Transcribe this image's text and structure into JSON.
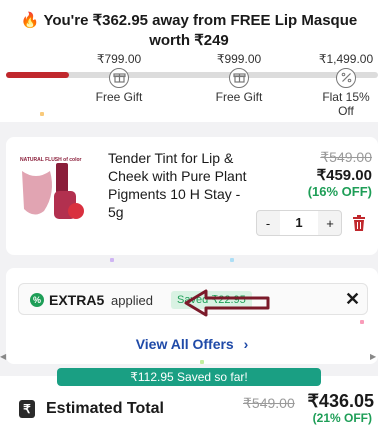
{
  "banner": {
    "message": "You're ₹362.95 away from FREE Lip Masque worth ₹249",
    "fire_icon": "fire-icon",
    "progress": 0.17,
    "colors": {
      "fill": "#c0282d",
      "track": "#dcdcdc"
    },
    "milestones": [
      {
        "price": "₹799.00",
        "label": "Free Gift",
        "icon": "gift-icon"
      },
      {
        "price": "₹999.00",
        "label": "Free Gift",
        "icon": "gift-icon"
      },
      {
        "price": "₹1,499.00",
        "label": "Flat 15% Off",
        "icon": "percent-icon"
      }
    ]
  },
  "product": {
    "name": "Tender Tint for Lip & Cheek with Pure Plant Pigments 10 H Stay - 5g",
    "thumb_text": "NATURAL FLUSH of color",
    "mrp": "₹549.00",
    "price": "₹459.00",
    "discount": "(16% OFF)",
    "quantity": "1",
    "minus": "-",
    "plus": "+"
  },
  "offers": {
    "code": "EXTRA5",
    "applied_label": "applied",
    "saved_label": "Saved ₹22.95",
    "close": "✕",
    "view_all": "View All Offers",
    "chevron": "›"
  },
  "summary": {
    "saved_so_far": "₹112.95 Saved so far!",
    "label": "Estimated Total",
    "mrp": "₹549.00",
    "total": "₹436.05",
    "discount": "(21% OFF)"
  },
  "colors": {
    "accent_red": "#c0282d",
    "green": "#1e9e57",
    "link_blue": "#1f4aa8",
    "teal": "#1a9f83"
  }
}
